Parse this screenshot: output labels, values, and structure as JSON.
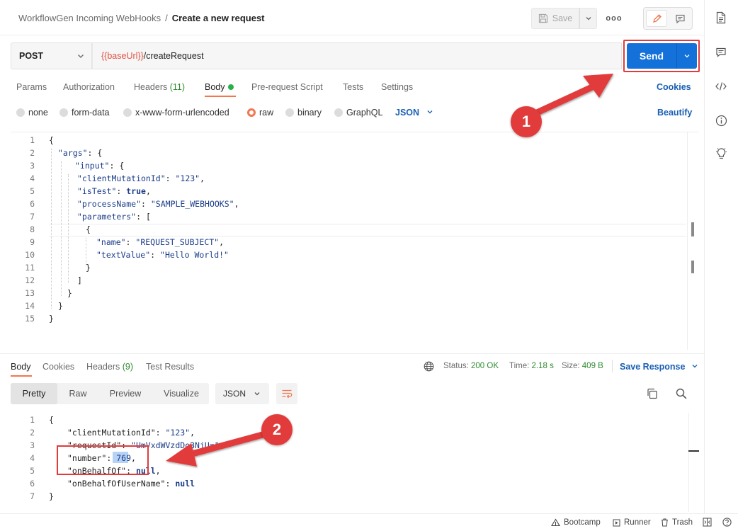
{
  "header": {
    "collection": "WorkflowGen Incoming WebHooks",
    "separator": "/",
    "request_name": "Create a new request",
    "save_label": "Save",
    "more_label": "ooo"
  },
  "request": {
    "method": "POST",
    "url_variable": "{{baseUrl}}",
    "url_path": "/createRequest",
    "send_label": "Send"
  },
  "tabs": [
    {
      "label": "Params"
    },
    {
      "label": "Authorization"
    },
    {
      "label": "Headers",
      "count": "(11)"
    },
    {
      "label": "Body"
    },
    {
      "label": "Pre-request Script"
    },
    {
      "label": "Tests"
    },
    {
      "label": "Settings"
    }
  ],
  "cookies_label": "Cookies",
  "body_types": [
    "none",
    "form-data",
    "x-www-form-urlencoded",
    "raw",
    "binary",
    "GraphQL"
  ],
  "body_type_selected": "raw",
  "body_lang": "JSON",
  "beautify_label": "Beautify",
  "editor_lines": [
    "1",
    "2",
    "3",
    "4",
    "5",
    "6",
    "7",
    "8",
    "9",
    "10",
    "11",
    "12",
    "13",
    "14",
    "15"
  ],
  "request_body": {
    "k_args": "\"args\"",
    "k_input": "\"input\"",
    "k_cmid": "\"clientMutationId\"",
    "v_cmid": "\"123\"",
    "k_istest": "\"isTest\"",
    "v_istest": "true",
    "k_procname": "\"processName\"",
    "v_procname": "\"SAMPLE_WEBHOOKS\"",
    "k_params": "\"parameters\"",
    "k_name": "\"name\"",
    "v_name": "\"REQUEST_SUBJECT\"",
    "k_textvalue": "\"textValue\"",
    "v_textvalue": "\"Hello World!\""
  },
  "response": {
    "tabs": [
      {
        "label": "Body"
      },
      {
        "label": "Cookies"
      },
      {
        "label": "Headers",
        "count": "(9)"
      },
      {
        "label": "Test Results"
      }
    ],
    "status_label": "Status:",
    "status_value": "200 OK",
    "time_label": "Time:",
    "time_value": "2.18 s",
    "size_label": "Size:",
    "size_value": "409 B",
    "save_response_label": "Save Response",
    "views": [
      "Pretty",
      "Raw",
      "Preview",
      "Visualize"
    ],
    "view_selected": "Pretty",
    "format": "JSON",
    "lines": [
      "1",
      "2",
      "3",
      "4",
      "5",
      "6",
      "7"
    ],
    "k_cmid": "\"clientMutationId\"",
    "v_cmid": "\"123\"",
    "k_reqid": "\"requestId\"",
    "v_reqid_visible": "\"UmVxdWVzdDo3NjU=\"",
    "k_number": "\"number\"",
    "v_number": "769",
    "k_obo": "\"onBehalfOf\"",
    "v_obo": "null",
    "k_obouser": "\"onBehalfOfUserName\"",
    "v_obouser": "null"
  },
  "footer": {
    "bootcamp": "Bootcamp",
    "runner": "Runner",
    "trash": "Trash"
  },
  "annotations": {
    "marker1": "1",
    "marker2": "2",
    "color": "#e23b3b"
  },
  "colors": {
    "send_blue": "#1371d9",
    "link_blue": "#1a5fb4",
    "status_green": "#2e8b2e",
    "url_var_red": "#e05243",
    "radio_orange": "#f2764e"
  }
}
